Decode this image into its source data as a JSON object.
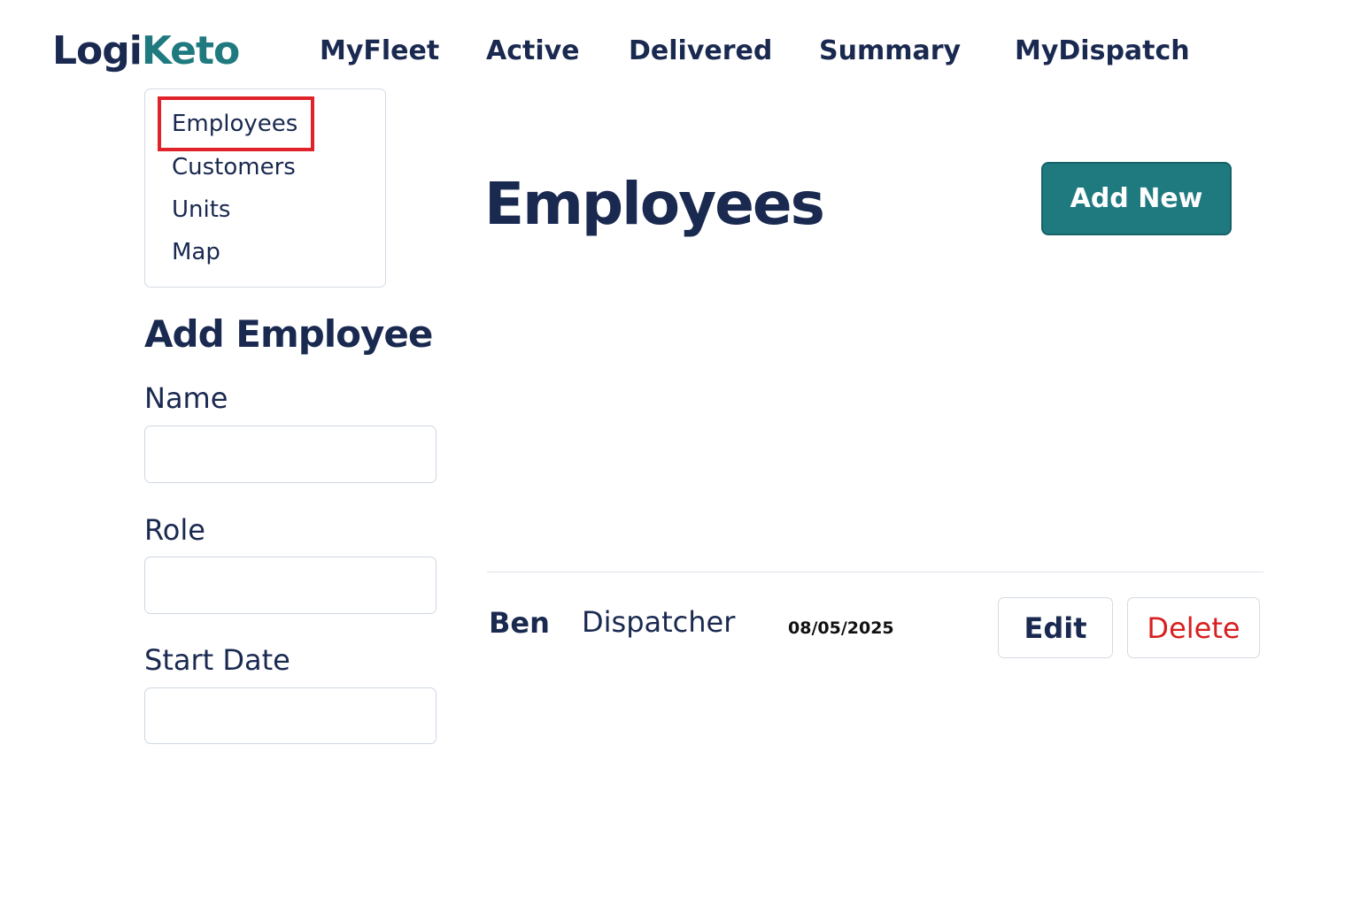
{
  "header": {
    "logo_part1": "Logi",
    "logo_part2": "Keto",
    "nav": [
      "MyFleet",
      "Active",
      "Delivered",
      "Summary",
      "MyDispatch"
    ]
  },
  "dropdown": {
    "items": [
      "Employees",
      "Customers",
      "Units",
      "Map"
    ],
    "highlighted": "Employees"
  },
  "form": {
    "title": "Add Employee",
    "fields": [
      {
        "label": "Name",
        "value": ""
      },
      {
        "label": "Role",
        "value": ""
      },
      {
        "label": "Start Date",
        "value": ""
      }
    ]
  },
  "main": {
    "title": "Employees",
    "add_button": "Add New",
    "rows": [
      {
        "name": "Ben",
        "role": "Dispatcher",
        "start_date": "08/05/2025",
        "edit_label": "Edit",
        "delete_label": "Delete"
      }
    ]
  },
  "colors": {
    "primary_text": "#1a2950",
    "accent": "#1f7a80",
    "danger": "#d81f1f",
    "highlight_outline": "#e0232b"
  }
}
